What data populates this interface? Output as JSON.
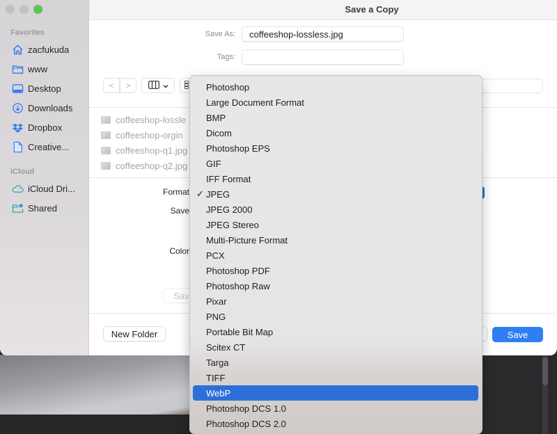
{
  "window": {
    "title": "Save a Copy",
    "traffic_lights": [
      "close",
      "minimize",
      "zoom"
    ]
  },
  "sidebar": {
    "sections": [
      {
        "header": "Favorites",
        "items": [
          {
            "label": "zacfukuda",
            "icon": "home-icon"
          },
          {
            "label": "www",
            "icon": "folder-icon"
          },
          {
            "label": "Desktop",
            "icon": "desktop-icon"
          },
          {
            "label": "Downloads",
            "icon": "download-icon"
          },
          {
            "label": "Dropbox",
            "icon": "dropbox-icon"
          },
          {
            "label": "Creative...",
            "icon": "document-icon"
          }
        ]
      },
      {
        "header": "iCloud",
        "items": [
          {
            "label": "iCloud Dri...",
            "icon": "cloud-icon"
          },
          {
            "label": "Shared",
            "icon": "shared-folder-icon"
          }
        ]
      }
    ]
  },
  "form": {
    "save_as_label": "Save As:",
    "save_as_value": "coffeeshop-lossless.jpg",
    "tags_label": "Tags:",
    "tags_value": ""
  },
  "toolbar": {
    "back": "<",
    "forward": ">",
    "view_mode": "columns"
  },
  "files": [
    {
      "name": "coffeeshop-lossle"
    },
    {
      "name": "coffeeshop-orgin"
    },
    {
      "name": "coffeeshop-q1.jpg"
    },
    {
      "name": "coffeeshop-q2.jpg"
    }
  ],
  "options": {
    "format_label": "Format",
    "save_label": "Save",
    "color_label": "Color",
    "save_preset_button": "Save"
  },
  "footer": {
    "new_folder": "New Folder",
    "save": "Save"
  },
  "format_menu": {
    "selected": "JPEG",
    "highlighted": "WebP",
    "items": [
      "Photoshop",
      "Large Document Format",
      "BMP",
      "Dicom",
      "Photoshop EPS",
      "GIF",
      "IFF Format",
      "JPEG",
      "JPEG 2000",
      "JPEG Stereo",
      "Multi-Picture Format",
      "PCX",
      "Photoshop PDF",
      "Photoshop Raw",
      "Pixar",
      "PNG",
      "Portable Bit Map",
      "Scitex CT",
      "Targa",
      "TIFF",
      "WebP",
      "Photoshop DCS 1.0",
      "Photoshop DCS 2.0"
    ]
  },
  "colors": {
    "accent": "#2f7ff3",
    "menu_highlight": "#2d6fd8",
    "sidebar_icon": "#3478f6"
  }
}
